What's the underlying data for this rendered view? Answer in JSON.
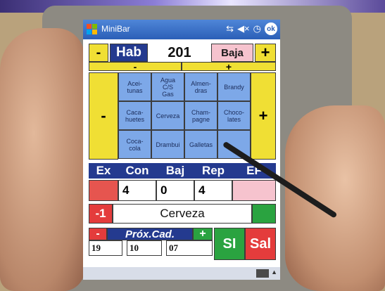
{
  "titlebar": {
    "app_title": "MiniBar",
    "icons": [
      "connectivity-icon",
      "volume-mute-icon",
      "clock-icon"
    ],
    "ok_label": "ok"
  },
  "room": {
    "minus": "-",
    "hab_label": "Hab",
    "number": "201",
    "baja_label": "Baja",
    "plus": "+",
    "sub_minus": "-",
    "sub_plus": "+"
  },
  "products": {
    "side_minus": "-",
    "side_plus": "+",
    "items": [
      "Acei-\ntunas",
      "Agua\nC/S\nGas",
      "Almen-\ndras",
      "Brandy",
      "Caca-\nhuetes",
      "Cerveza",
      "Cham-\npagne",
      "Choco-\nlates",
      "Coca-\ncola",
      "Drambui",
      "Galletas",
      ""
    ]
  },
  "stock": {
    "headers": [
      "Ex",
      "Con",
      "Baj",
      "Rep",
      "EF"
    ],
    "values": [
      "",
      "4",
      "0",
      "4",
      ""
    ]
  },
  "selected": {
    "minus_one": "-1",
    "product": "Cerveza"
  },
  "expiry": {
    "minus": "-",
    "label": "Próx.Cad.",
    "plus": "+",
    "day": "19",
    "month": "10",
    "year": "07",
    "si": "SI",
    "sal": "Sal"
  },
  "colors": {
    "yellow": "#f0df34",
    "navy": "#243a8f",
    "pink": "#f6c3ce",
    "red": "#e43c3c",
    "green": "#2aa340",
    "product_blue": "#7da8e8"
  }
}
